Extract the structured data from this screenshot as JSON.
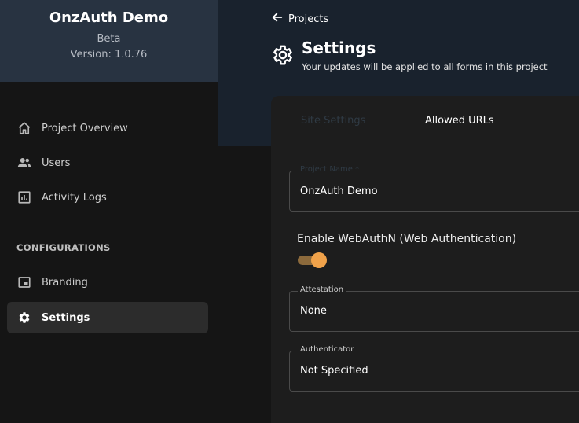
{
  "app": {
    "name": "OnzAuth Demo",
    "channel": "Beta",
    "version": "Version: 1.0.76"
  },
  "sidebar": {
    "items": [
      {
        "label": "Project Overview",
        "icon": "home-icon"
      },
      {
        "label": "Users",
        "icon": "users-icon"
      },
      {
        "label": "Activity Logs",
        "icon": "bar-chart-icon"
      }
    ],
    "section_title": "CONFIGURATIONS",
    "config_items": [
      {
        "label": "Branding",
        "icon": "branding-icon"
      },
      {
        "label": "Settings",
        "icon": "gear-icon",
        "active": true
      }
    ]
  },
  "header": {
    "back_label": "Projects",
    "title": "Settings",
    "subtitle": "Your updates will be applied to all forms in this project"
  },
  "tabs": [
    {
      "label": "Site Settings",
      "active": false
    },
    {
      "label": "Allowed URLs",
      "active": true
    }
  ],
  "form": {
    "project_name": {
      "label": "Project Name *",
      "value": "OnzAuth Demo"
    },
    "webauthn": {
      "label": "Enable WebAuthN (Web Authentication)",
      "enabled": true
    },
    "attestation": {
      "label": "Attestation",
      "value": "None"
    },
    "authenticator": {
      "label": "Authenticator",
      "value": "Not Specified"
    }
  },
  "colors": {
    "sidebar_header": "#283341",
    "banner": "#19222d",
    "accent": "#f0a24a"
  }
}
